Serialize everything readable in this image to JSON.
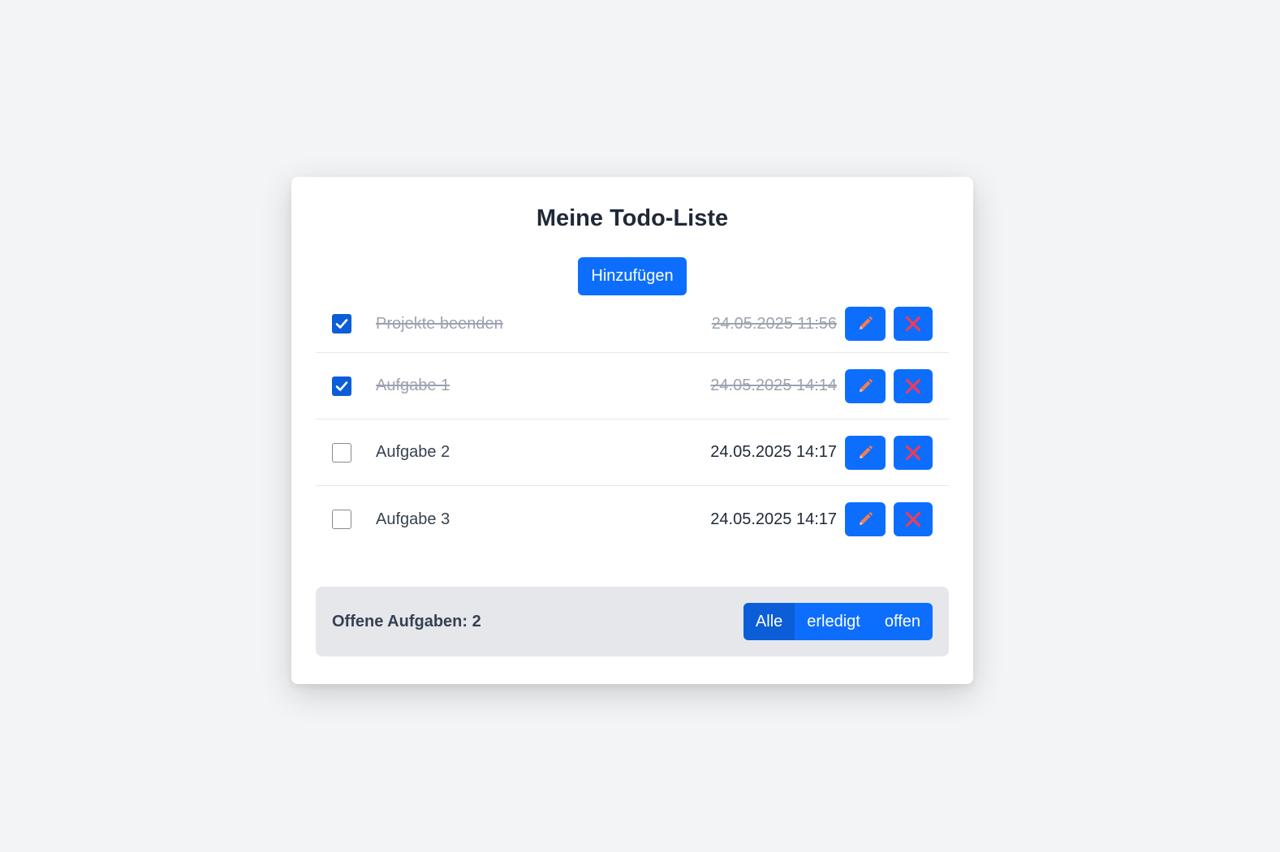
{
  "title": "Meine Todo-Liste",
  "add_button_label": "Hinzufügen",
  "todos": [
    {
      "text": "Projekte beenden",
      "date": "24.05.2025 11:56",
      "done": true
    },
    {
      "text": "Aufgabe 1",
      "date": "24.05.2025 14:14",
      "done": true
    },
    {
      "text": "Aufgabe 2",
      "date": "24.05.2025 14:17",
      "done": false
    },
    {
      "text": "Aufgabe 3",
      "date": "24.05.2025 14:17",
      "done": false
    }
  ],
  "icons": {
    "edit": "pencil-icon",
    "delete": "x-icon",
    "check": "checkmark-icon"
  },
  "footer": {
    "open_count_label": "Offene Aufgaben: 2",
    "filters": [
      "Alle",
      "erledigt",
      "offen"
    ],
    "active_filter": "Alle"
  },
  "colors": {
    "primary": "#0d6efd",
    "primary_active": "#0b5ed7",
    "pencil": "#f97c4b",
    "delete_x": "#ef3b5a",
    "background": "#f3f4f6"
  }
}
